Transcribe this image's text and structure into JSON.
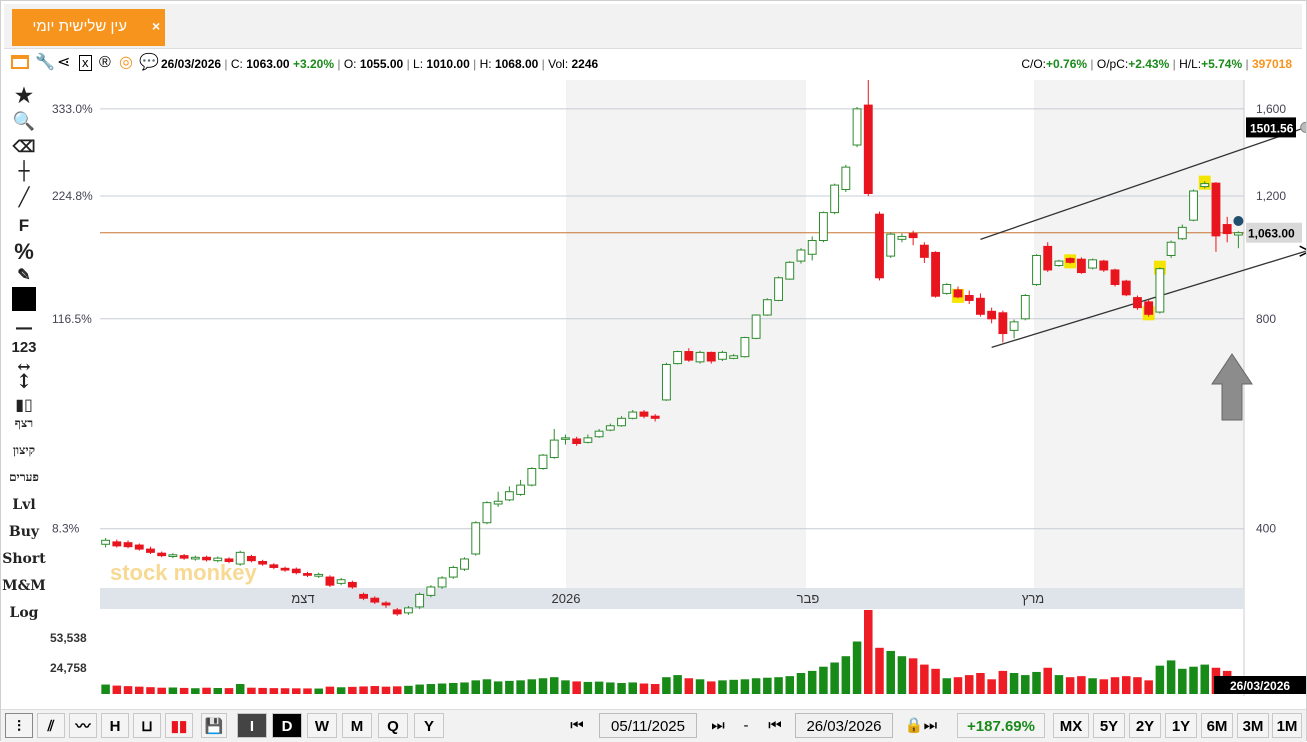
{
  "tab": {
    "title": "עין שלישית יומי",
    "close": "×"
  },
  "info": {
    "date": "26/03/2026",
    "close_label": "C:",
    "close": "1063.00",
    "change": "+3.20%",
    "open_label": "O:",
    "open": "1055.00",
    "low_label": "L:",
    "low": "1010.00",
    "high_label": "H:",
    "high": "1068.00",
    "vol_label": "Vol:",
    "vol": "2246",
    "co_label": "C/O:",
    "co": "+0.76%",
    "opc_label": "O/pC:",
    "opc": "+2.43%",
    "hl_label": "H/L:",
    "hl": "+5.74%",
    "id": "397018"
  },
  "toolbar_icons": [
    "window-icon",
    "wrench-icon",
    "share-icon",
    "excel-icon",
    "registered-icon",
    "target-icon",
    "comment-icon"
  ],
  "left_tools": {
    "icons": [
      "star-icon",
      "search-icon",
      "eraser-icon",
      "crosshair-icon",
      "line-icon"
    ],
    "f": "F",
    "percent": "%",
    "num": "123",
    "heb1": "רצף",
    "heb2": "קיצון",
    "heb3": "פערים",
    "lvl": "Lvl",
    "buy": "Buy",
    "short": "Short",
    "mm": "M&M",
    "log": "Log"
  },
  "colors": {
    "up": "#2e8b2e",
    "down": "#e8141e",
    "accent": "#f7941d",
    "hline": "#c87533",
    "highlight": "#f5e400"
  },
  "watermark": "stock monkey",
  "chart_data": {
    "type": "candlestick",
    "title": "",
    "ylim": [
      330,
      1760
    ],
    "y_ticks_right": [
      "1,600",
      "1,200",
      "800",
      "400"
    ],
    "y_ticks_left": [
      "333.0%",
      "224.8%",
      "116.5%",
      "8.3%"
    ],
    "month_labels": [
      "דצמ",
      "2026",
      "פבר",
      "מרץ"
    ],
    "price_label": "1,063.00",
    "channel_label": "1501.56",
    "volume_ticks": [
      "53,538",
      "24,758"
    ],
    "last_date_label": "26/03/2026",
    "candles": [
      {
        "d": "05/11/2025",
        "o": 380,
        "c": 385,
        "h": 388,
        "l": 376,
        "v": 9000
      },
      {
        "d": "06/11/2025",
        "o": 383,
        "c": 378,
        "h": 386,
        "l": 376,
        "v": 8000
      },
      {
        "d": "09/11/2025",
        "o": 382,
        "c": 377,
        "h": 385,
        "l": 375,
        "v": 7500
      },
      {
        "d": "10/11/2025",
        "o": 379,
        "c": 374,
        "h": 381,
        "l": 372,
        "v": 7000
      },
      {
        "d": "11/11/2025",
        "o": 374,
        "c": 370,
        "h": 377,
        "l": 368,
        "v": 6500
      },
      {
        "d": "12/11/2025",
        "o": 369,
        "c": 366,
        "h": 371,
        "l": 364,
        "v": 6000
      },
      {
        "d": "13/11/2025",
        "o": 365,
        "c": 367,
        "h": 369,
        "l": 363,
        "v": 6200
      },
      {
        "d": "16/11/2025",
        "o": 366,
        "c": 363,
        "h": 368,
        "l": 361,
        "v": 5800
      },
      {
        "d": "17/11/2025",
        "o": 362,
        "c": 364,
        "h": 366,
        "l": 360,
        "v": 5500
      },
      {
        "d": "18/11/2025",
        "o": 364,
        "c": 361,
        "h": 366,
        "l": 359,
        "v": 6000
      },
      {
        "d": "19/11/2025",
        "o": 360,
        "c": 363,
        "h": 365,
        "l": 358,
        "v": 5700
      },
      {
        "d": "20/11/2025",
        "o": 362,
        "c": 359,
        "h": 364,
        "l": 357,
        "v": 5600
      },
      {
        "d": "23/11/2025",
        "o": 356,
        "c": 370,
        "h": 372,
        "l": 354,
        "v": 9500
      },
      {
        "d": "24/11/2025",
        "o": 365,
        "c": 360,
        "h": 367,
        "l": 358,
        "v": 6000
      },
      {
        "d": "25/11/2025",
        "o": 359,
        "c": 356,
        "h": 361,
        "l": 354,
        "v": 5800
      },
      {
        "d": "26/11/2025",
        "o": 355,
        "c": 352,
        "h": 357,
        "l": 350,
        "v": 5600
      },
      {
        "d": "27/11/2025",
        "o": 351,
        "c": 349,
        "h": 353,
        "l": 347,
        "v": 5500
      },
      {
        "d": "30/11/2025",
        "o": 350,
        "c": 346,
        "h": 352,
        "l": 344,
        "v": 5400
      },
      {
        "d": "01/12/2025",
        "o": 345,
        "c": 343,
        "h": 347,
        "l": 341,
        "v": 5300
      },
      {
        "d": "02/12/2025",
        "o": 342,
        "c": 344,
        "h": 346,
        "l": 340,
        "v": 5200
      },
      {
        "d": "03/12/2025",
        "o": 341,
        "c": 332,
        "h": 343,
        "l": 330,
        "v": 7000
      },
      {
        "d": "04/12/2025",
        "o": 334,
        "c": 338,
        "h": 340,
        "l": 332,
        "v": 6400
      },
      {
        "d": "07/12/2025",
        "o": 335,
        "c": 330,
        "h": 337,
        "l": 328,
        "v": 6800
      },
      {
        "d": "08/12/2025",
        "o": 322,
        "c": 318,
        "h": 324,
        "l": 316,
        "v": 7200
      },
      {
        "d": "09/12/2025",
        "o": 318,
        "c": 314,
        "h": 320,
        "l": 312,
        "v": 7600
      },
      {
        "d": "10/12/2025",
        "o": 313,
        "c": 311,
        "h": 315,
        "l": 308,
        "v": 7000
      },
      {
        "d": "11/12/2025",
        "o": 306,
        "c": 302,
        "h": 308,
        "l": 300,
        "v": 7300
      },
      {
        "d": "14/12/2025",
        "o": 303,
        "c": 308,
        "h": 310,
        "l": 301,
        "v": 7800
      },
      {
        "d": "15/12/2025",
        "o": 309,
        "c": 322,
        "h": 324,
        "l": 307,
        "v": 9000
      },
      {
        "d": "16/12/2025",
        "o": 321,
        "c": 330,
        "h": 332,
        "l": 319,
        "v": 9500
      },
      {
        "d": "17/12/2025",
        "o": 330,
        "c": 340,
        "h": 342,
        "l": 328,
        "v": 10000
      },
      {
        "d": "18/12/2025",
        "o": 341,
        "c": 352,
        "h": 354,
        "l": 339,
        "v": 10500
      },
      {
        "d": "21/12/2025",
        "o": 350,
        "c": 362,
        "h": 364,
        "l": 348,
        "v": 11000
      },
      {
        "d": "22/12/2025",
        "o": 368,
        "c": 408,
        "h": 410,
        "l": 366,
        "v": 13000
      },
      {
        "d": "23/12/2025",
        "o": 408,
        "c": 436,
        "h": 438,
        "l": 406,
        "v": 14000
      },
      {
        "d": "24/12/2025",
        "o": 434,
        "c": 438,
        "h": 452,
        "l": 430,
        "v": 12000
      },
      {
        "d": "25/12/2025",
        "o": 440,
        "c": 452,
        "h": 460,
        "l": 438,
        "v": 12500
      },
      {
        "d": "28/12/2025",
        "o": 448,
        "c": 462,
        "h": 470,
        "l": 446,
        "v": 13000
      },
      {
        "d": "29/12/2025",
        "o": 462,
        "c": 488,
        "h": 490,
        "l": 460,
        "v": 14000
      },
      {
        "d": "30/12/2025",
        "o": 488,
        "c": 510,
        "h": 512,
        "l": 486,
        "v": 15000
      },
      {
        "d": "31/12/2025",
        "o": 506,
        "c": 536,
        "h": 556,
        "l": 504,
        "v": 16000
      },
      {
        "d": "01/01/2026",
        "o": 538,
        "c": 540,
        "h": 546,
        "l": 528,
        "v": 13000
      },
      {
        "d": "04/01/2026",
        "o": 538,
        "c": 530,
        "h": 542,
        "l": 526,
        "v": 12000
      },
      {
        "d": "05/01/2026",
        "o": 532,
        "c": 540,
        "h": 546,
        "l": 530,
        "v": 11500
      },
      {
        "d": "06/01/2026",
        "o": 542,
        "c": 552,
        "h": 556,
        "l": 540,
        "v": 11800
      },
      {
        "d": "07/01/2026",
        "o": 554,
        "c": 562,
        "h": 566,
        "l": 552,
        "v": 11000
      },
      {
        "d": "08/01/2026",
        "o": 562,
        "c": 576,
        "h": 580,
        "l": 560,
        "v": 10500
      },
      {
        "d": "11/01/2026",
        "o": 576,
        "c": 588,
        "h": 592,
        "l": 574,
        "v": 11000
      },
      {
        "d": "12/01/2026",
        "o": 588,
        "c": 580,
        "h": 592,
        "l": 576,
        "v": 10000
      },
      {
        "d": "13/01/2026",
        "o": 580,
        "c": 576,
        "h": 584,
        "l": 570,
        "v": 9500
      },
      {
        "d": "14/01/2026",
        "o": 612,
        "c": 688,
        "h": 692,
        "l": 610,
        "v": 16000
      },
      {
        "d": "15/01/2026",
        "o": 690,
        "c": 718,
        "h": 720,
        "l": 688,
        "v": 18000
      },
      {
        "d": "18/01/2026",
        "o": 718,
        "c": 698,
        "h": 726,
        "l": 694,
        "v": 15000
      },
      {
        "d": "19/01/2026",
        "o": 694,
        "c": 716,
        "h": 720,
        "l": 690,
        "v": 14000
      },
      {
        "d": "20/01/2026",
        "o": 716,
        "c": 696,
        "h": 718,
        "l": 690,
        "v": 12000
      },
      {
        "d": "21/01/2026",
        "o": 700,
        "c": 716,
        "h": 720,
        "l": 696,
        "v": 13000
      },
      {
        "d": "22/01/2026",
        "o": 702,
        "c": 708,
        "h": 712,
        "l": 700,
        "v": 13500
      },
      {
        "d": "25/01/2026",
        "o": 706,
        "c": 752,
        "h": 754,
        "l": 704,
        "v": 14000
      },
      {
        "d": "26/01/2026",
        "o": 750,
        "c": 810,
        "h": 812,
        "l": 748,
        "v": 15000
      },
      {
        "d": "27/01/2026",
        "o": 810,
        "c": 852,
        "h": 856,
        "l": 808,
        "v": 15500
      },
      {
        "d": "28/01/2026",
        "o": 850,
        "c": 916,
        "h": 920,
        "l": 848,
        "v": 16000
      },
      {
        "d": "29/01/2026",
        "o": 912,
        "c": 964,
        "h": 968,
        "l": 910,
        "v": 17000
      },
      {
        "d": "01/02/2026",
        "o": 968,
        "c": 1004,
        "h": 1010,
        "l": 960,
        "v": 20000
      },
      {
        "d": "02/02/2026",
        "o": 990,
        "c": 1036,
        "h": 1050,
        "l": 970,
        "v": 22000
      },
      {
        "d": "03/02/2026",
        "o": 1036,
        "c": 1136,
        "h": 1140,
        "l": 1030,
        "v": 26000
      },
      {
        "d": "04/02/2026",
        "o": 1136,
        "c": 1244,
        "h": 1250,
        "l": 1130,
        "v": 30000
      },
      {
        "d": "05/02/2026",
        "o": 1226,
        "c": 1320,
        "h": 1330,
        "l": 1216,
        "v": 36000
      },
      {
        "d": "08/02/2026",
        "o": 1420,
        "c": 1600,
        "h": 1610,
        "l": 1410,
        "v": 50000
      },
      {
        "d": "09/02/2026",
        "o": 1620,
        "c": 1210,
        "h": 1870,
        "l": 1200,
        "v": 80000
      },
      {
        "d": "10/02/2026",
        "o": 1130,
        "c": 916,
        "h": 1140,
        "l": 908,
        "v": 44000
      },
      {
        "d": "11/02/2026",
        "o": 984,
        "c": 1058,
        "h": 1064,
        "l": 978,
        "v": 41000
      },
      {
        "d": "12/02/2026",
        "o": 1040,
        "c": 1050,
        "h": 1060,
        "l": 1030,
        "v": 36000
      },
      {
        "d": "15/02/2026",
        "o": 1060,
        "c": 1046,
        "h": 1070,
        "l": 1020,
        "v": 34000
      },
      {
        "d": "16/02/2026",
        "o": 1020,
        "c": 980,
        "h": 1030,
        "l": 962,
        "v": 28000
      },
      {
        "d": "17/02/2026",
        "o": 996,
        "c": 862,
        "h": 1000,
        "l": 858,
        "v": 24000
      },
      {
        "d": "18/02/2026",
        "o": 870,
        "c": 896,
        "h": 900,
        "l": 866,
        "v": 15000
      },
      {
        "d": "19/02/2026",
        "o": 880,
        "c": 860,
        "h": 890,
        "l": 856,
        "v": 16000
      },
      {
        "d": "22/02/2026",
        "o": 864,
        "c": 850,
        "h": 878,
        "l": 840,
        "v": 18000
      },
      {
        "d": "23/02/2026",
        "o": 856,
        "c": 812,
        "h": 870,
        "l": 806,
        "v": 20000
      },
      {
        "d": "24/02/2026",
        "o": 820,
        "c": 800,
        "h": 830,
        "l": 788,
        "v": 14000
      },
      {
        "d": "25/02/2026",
        "o": 816,
        "c": 762,
        "h": 822,
        "l": 740,
        "v": 22000
      },
      {
        "d": "26/02/2026",
        "o": 770,
        "c": 792,
        "h": 798,
        "l": 750,
        "v": 20000
      },
      {
        "d": "01/03/2026",
        "o": 800,
        "c": 864,
        "h": 868,
        "l": 796,
        "v": 18000
      },
      {
        "d": "02/03/2026",
        "o": 896,
        "c": 986,
        "h": 990,
        "l": 892,
        "v": 21000
      },
      {
        "d": "03/03/2026",
        "o": 1016,
        "c": 940,
        "h": 1030,
        "l": 934,
        "v": 25000
      },
      {
        "d": "04/03/2026",
        "o": 954,
        "c": 968,
        "h": 972,
        "l": 950,
        "v": 18000
      },
      {
        "d": "05/03/2026",
        "o": 976,
        "c": 964,
        "h": 980,
        "l": 960,
        "v": 16000
      },
      {
        "d": "08/03/2026",
        "o": 974,
        "c": 932,
        "h": 980,
        "l": 928,
        "v": 17000
      },
      {
        "d": "09/03/2026",
        "o": 946,
        "c": 972,
        "h": 976,
        "l": 942,
        "v": 15000
      },
      {
        "d": "10/03/2026",
        "o": 968,
        "c": 940,
        "h": 972,
        "l": 934,
        "v": 14000
      },
      {
        "d": "11/03/2026",
        "o": 940,
        "c": 896,
        "h": 944,
        "l": 890,
        "v": 16000
      },
      {
        "d": "12/03/2026",
        "o": 906,
        "c": 866,
        "h": 910,
        "l": 862,
        "v": 17000
      },
      {
        "d": "15/03/2026",
        "o": 858,
        "c": 830,
        "h": 864,
        "l": 824,
        "v": 16000
      },
      {
        "d": "16/03/2026",
        "o": 846,
        "c": 812,
        "h": 852,
        "l": 806,
        "v": 13000
      },
      {
        "d": "17/03/2026",
        "o": 818,
        "c": 944,
        "h": 948,
        "l": 814,
        "v": 27000
      },
      {
        "d": "18/03/2026",
        "o": 986,
        "c": 1030,
        "h": 1036,
        "l": 978,
        "v": 32000
      },
      {
        "d": "19/03/2026",
        "o": 1042,
        "c": 1082,
        "h": 1092,
        "l": 1038,
        "v": 24000
      },
      {
        "d": "22/03/2026",
        "o": 1108,
        "c": 1220,
        "h": 1226,
        "l": 1104,
        "v": 26000
      },
      {
        "d": "23/03/2026",
        "o": 1238,
        "c": 1250,
        "h": 1260,
        "l": 1230,
        "v": 28000
      },
      {
        "d": "24/03/2026",
        "o": 1252,
        "c": 1052,
        "h": 1256,
        "l": 998,
        "v": 25000
      },
      {
        "d": "25/03/2026",
        "o": 1092,
        "c": 1060,
        "h": 1120,
        "l": 1030,
        "v": 22000
      },
      {
        "d": "26/03/2026",
        "o": 1055,
        "c": 1063,
        "h": 1068,
        "l": 1010,
        "v": 2246
      }
    ]
  },
  "bottom": {
    "chart_types": [
      "candle",
      "ohlc",
      "line",
      "hl",
      "bar",
      "colored"
    ],
    "period_buttons": [
      "I",
      "D",
      "W",
      "M",
      "Q",
      "Y"
    ],
    "start_date": "05/11/2025",
    "end_date": "26/03/2026",
    "dash": "-",
    "change": "+187.69%",
    "range_buttons": [
      "MX",
      "5Y",
      "2Y",
      "1Y",
      "6M",
      "3M",
      "1M"
    ]
  }
}
